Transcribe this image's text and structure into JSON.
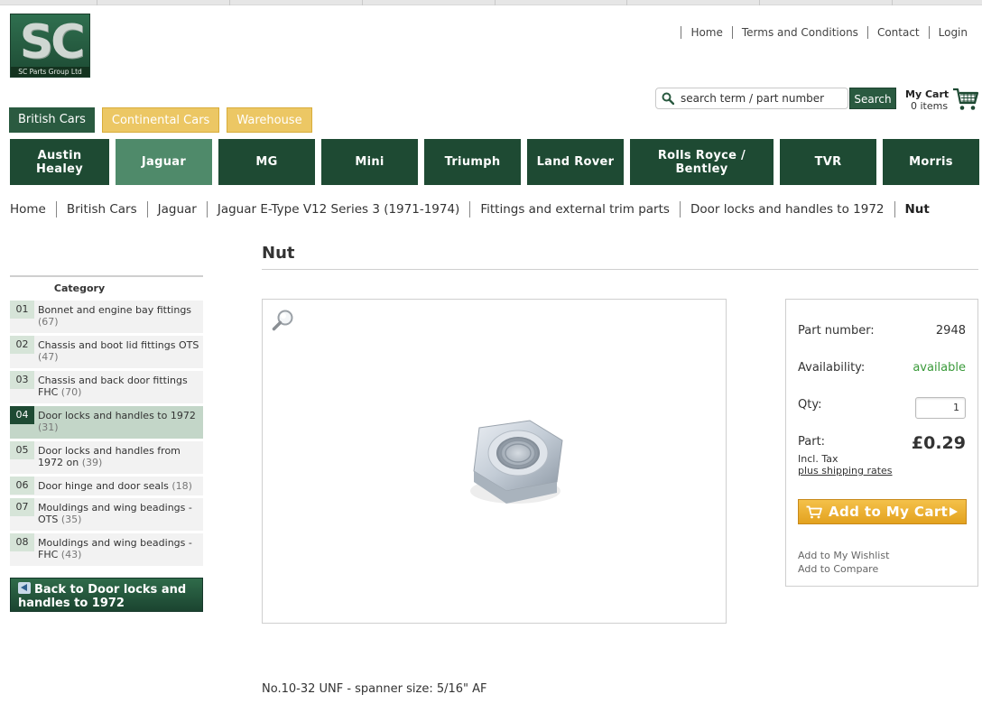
{
  "logo": {
    "text": "SC",
    "tagline": "SC Parts Group Ltd"
  },
  "top_links": [
    "Home",
    "Terms and Conditions",
    "Contact",
    "Login"
  ],
  "search": {
    "placeholder": "search term / part number",
    "button": "Search"
  },
  "cart": {
    "title": "My Cart",
    "items": "0 items"
  },
  "category_tabs": [
    "British Cars",
    "Continental Cars",
    "Warehouse"
  ],
  "brands": [
    "Austin Healey",
    "Jaguar",
    "MG",
    "Mini",
    "Triumph",
    "Land Rover",
    "Rolls Royce / Bentley",
    "TVR",
    "Morris"
  ],
  "breadcrumb": [
    "Home",
    "British Cars",
    "Jaguar",
    "Jaguar E-Type V12 Series 3 (1971-1974)",
    "Fittings and external trim parts",
    "Door locks and handles to 1972",
    "Nut"
  ],
  "page_title": "Nut",
  "sidebar": {
    "heading": "Category",
    "items": [
      {
        "num": "01",
        "name": "Bonnet and engine bay fittings",
        "count": "(67)"
      },
      {
        "num": "02",
        "name": "Chassis and boot lid fittings OTS",
        "count": "(47)"
      },
      {
        "num": "03",
        "name": "Chassis and back door fittings FHC",
        "count": "(70)"
      },
      {
        "num": "04",
        "name": "Door locks and handles to 1972",
        "count": "(31)"
      },
      {
        "num": "05",
        "name": "Door locks and handles from 1972 on",
        "count": "(39)"
      },
      {
        "num": "06",
        "name": "Door hinge and door seals",
        "count": "(18)"
      },
      {
        "num": "07",
        "name": "Mouldings and wing beadings - OTS",
        "count": "(35)"
      },
      {
        "num": "08",
        "name": "Mouldings and wing beadings - FHC",
        "count": "(43)"
      }
    ],
    "back_label": "Back to Door locks and handles to 1972"
  },
  "product": {
    "part_number_label": "Part number:",
    "part_number": "2948",
    "availability_label": "Availability:",
    "availability": "available",
    "qty_label": "Qty:",
    "qty": "1",
    "price_label": "Part:",
    "price": "£0.29",
    "incl_tax": "Incl. Tax",
    "shipping": "plus shipping rates",
    "add_to_cart": "Add to My Cart",
    "wishlist": "Add to My Wishlist",
    "compare": "Add to Compare",
    "description": "No.10-32 UNF - spanner size: 5/16\" AF"
  },
  "colors": {
    "primary_green": "#1e4a33",
    "active_green": "#4f8a6a",
    "gold": "#ecc764",
    "cart_orange": "#e3a21f",
    "available_green": "#3a9a3a"
  }
}
